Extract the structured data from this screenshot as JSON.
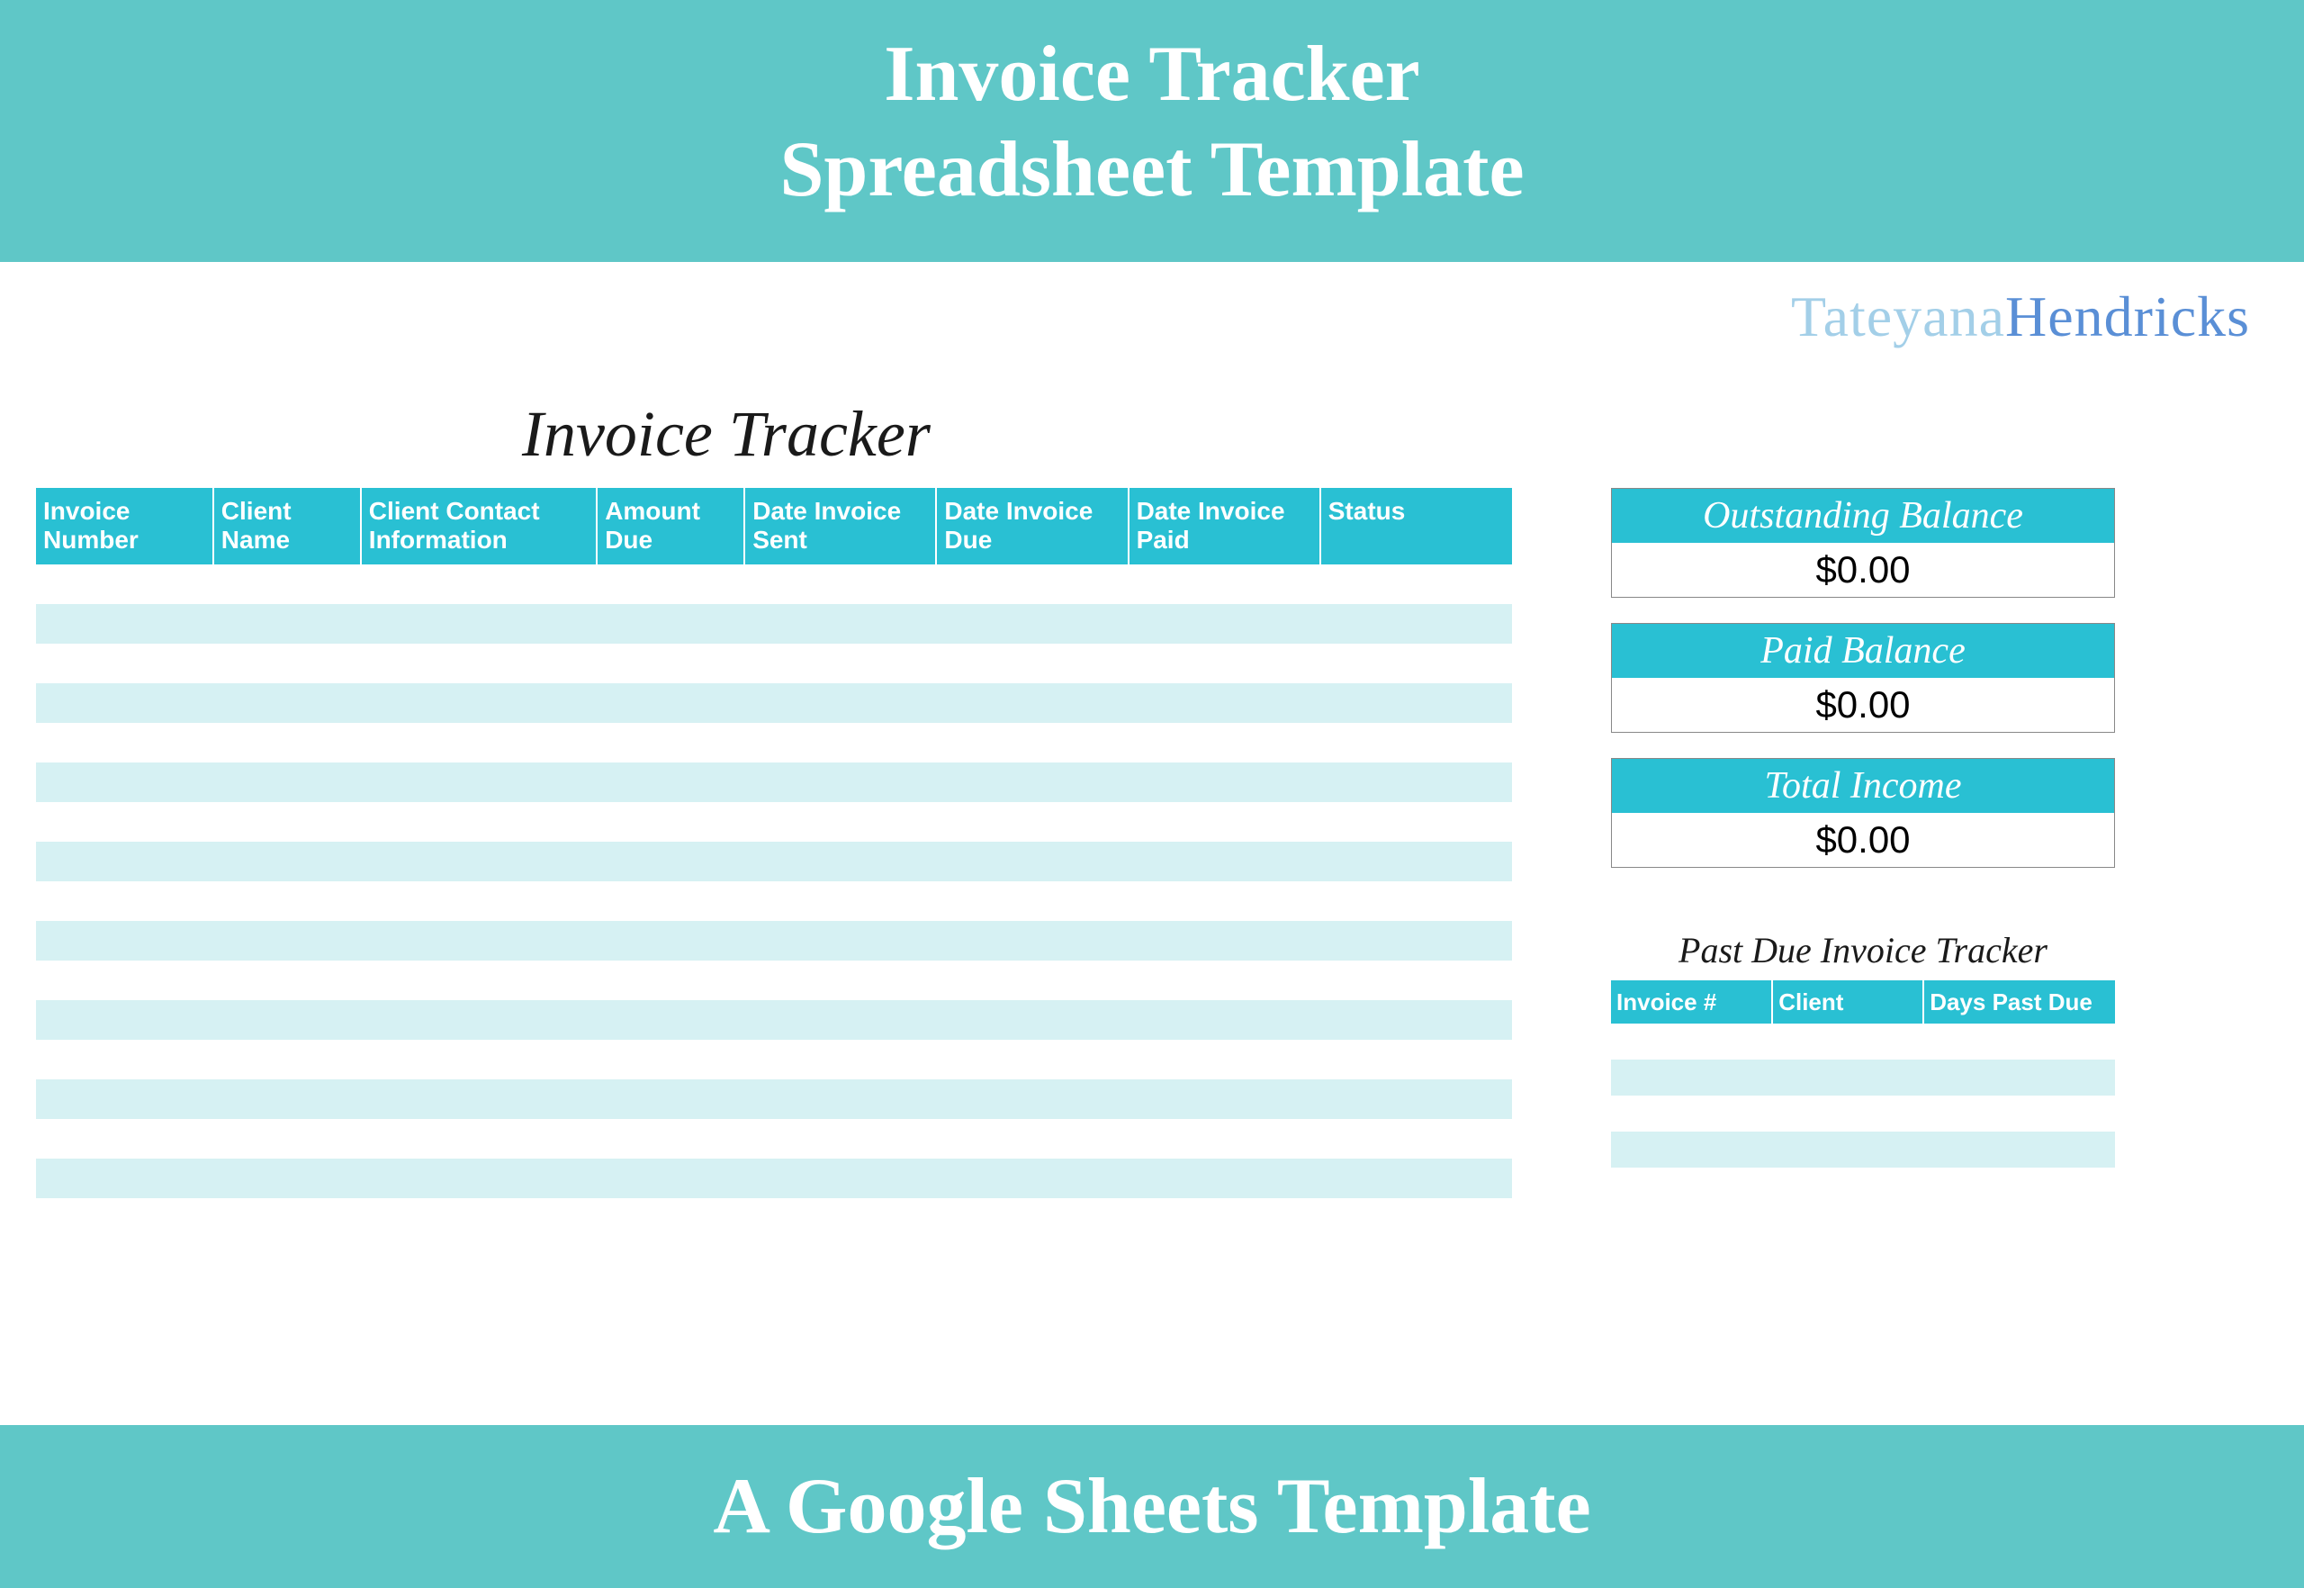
{
  "banner": {
    "line1": "Invoice Tracker",
    "line2": "Spreadsheet Template",
    "bottom": "A Google Sheets Template"
  },
  "brand": {
    "first": "Tateyana",
    "last": "Hendricks"
  },
  "sheet": {
    "title": "Invoice Tracker",
    "columns": [
      "Invoice Number",
      "Client Name",
      "Client Contact Information",
      "Amount Due",
      "Date Invoice Sent",
      "Date Invoice Due",
      "Date Invoice Paid",
      "Status"
    ],
    "row_count": 16
  },
  "summary": {
    "outstanding": {
      "label": "Outstanding Balance",
      "value": "$0.00"
    },
    "paid": {
      "label": "Paid Balance",
      "value": "$0.00"
    },
    "total": {
      "label": "Total Income",
      "value": "$0.00"
    }
  },
  "past_due": {
    "title": "Past Due Invoice Tracker",
    "columns": [
      "Invoice #",
      "Client",
      "Days Past Due"
    ],
    "row_count": 4
  },
  "colors": {
    "banner_bg": "#5fc7c7",
    "header_bg": "#29c0d3",
    "stripe": "#d6f1f3"
  }
}
